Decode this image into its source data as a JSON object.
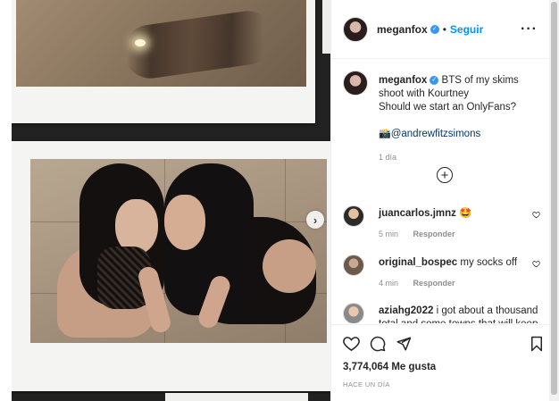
{
  "post": {
    "username": "meganfox",
    "follow_label": "Seguir",
    "dot": "•",
    "more_icon": "more-icon",
    "caption_line1": "BTS of my skims shoot with Kourtney",
    "caption_line2": "Should we start an OnlyFans?",
    "caption_camera": "📸",
    "caption_mention": "@andrewfitzsimons",
    "caption_time": "1 día"
  },
  "comments": [
    {
      "username": "juancarlos.jmnz",
      "text": "🤩",
      "time": "5 min",
      "reply": "Responder"
    },
    {
      "username": "original_bospec",
      "text": "my socks off",
      "time": "4 min",
      "reply": "Responder"
    },
    {
      "username": "aziahg2022",
      "text": "i got about a thousand total and some towns that will keep ot"
    }
  ],
  "actions": {
    "likes": "3,774,064 Me gusta",
    "posted": "HACE UN DÍA"
  },
  "media": {
    "next_icon": "›"
  },
  "colors": {
    "accent": "#0095f6",
    "verified": "#3897f0",
    "muted": "#8e8e8e"
  }
}
